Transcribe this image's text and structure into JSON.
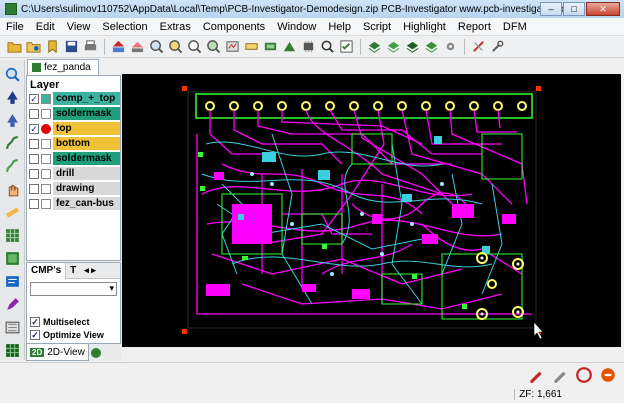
{
  "window": {
    "title": "C:\\Users\\sulimov110752\\AppData\\Local\\Temp\\PCB-Investigator-Demodesign.zip   PCB-Investigator   www.pcb-investigator.com",
    "minimize": "–",
    "maximize": "□",
    "close": "✕"
  },
  "menu": [
    "File",
    "Edit",
    "View",
    "Selection",
    "Extras",
    "Components",
    "Window",
    "Help",
    "Script",
    "Highlight",
    "Report",
    "DFM"
  ],
  "document_tab": {
    "label": "fez_panda"
  },
  "layer_panel": {
    "title": "Layer",
    "layers": [
      {
        "name": "comp_+_top",
        "checked": true,
        "color": "#3cb3a0"
      },
      {
        "name": "soldermask",
        "checked": false,
        "color": "#1fa07a"
      },
      {
        "name": "top",
        "checked": true,
        "color": "#f0c238"
      },
      {
        "name": "bottom",
        "checked": false,
        "color": "#f0c238"
      },
      {
        "name": "soldermask",
        "checked": false,
        "color": "#1fa07a"
      },
      {
        "name": "drill",
        "checked": false,
        "color": "#d8d8d8"
      },
      {
        "name": "drawing",
        "checked": false,
        "color": "#d8d8d8"
      },
      {
        "name": "fez_can-bus",
        "checked": false,
        "color": "#d8d8d8"
      }
    ]
  },
  "cmp_panel": {
    "tab_label": "CMP's",
    "next_tab": "T",
    "options": [
      {
        "label": "Multiselect",
        "checked": true
      },
      {
        "label": "Optimize View",
        "checked": true
      }
    ]
  },
  "view_tabs": {
    "badge": "2D",
    "label": "2D-View"
  },
  "status": {
    "zoom": "ZF: 1,661"
  },
  "colors": {
    "board_bg": "#000000",
    "copper_top": "#ff00ff",
    "copper_bottom": "#3ad0e0",
    "outline": "#33ff33",
    "pad": "#ffff66"
  }
}
